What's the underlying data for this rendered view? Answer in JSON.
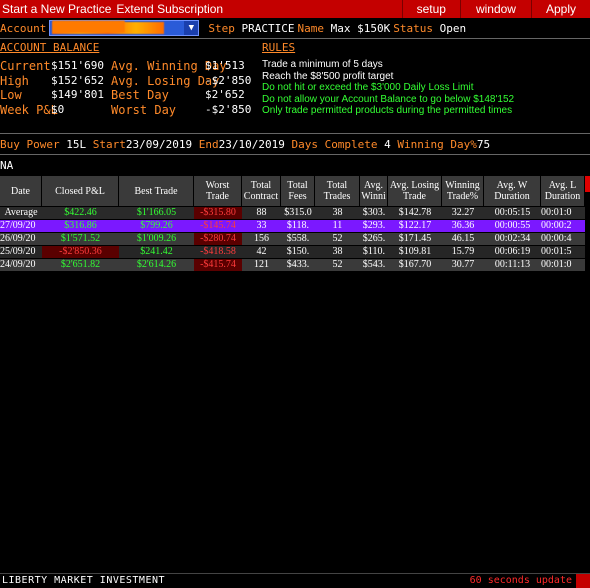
{
  "menu": {
    "start_label": "Start a New Practice",
    "extend_label": "Extend Subscription",
    "setup_label": "setup",
    "window_label": "window",
    "apply_label": "Apply"
  },
  "account": {
    "label": "Account",
    "value": "████████████",
    "step_label": "Step",
    "step_value": "PRACTICE",
    "name_label": "Name",
    "name_value": "Max $150K",
    "status_label": "Status",
    "status_value": "Open"
  },
  "balance": {
    "title": "ACCOUNT BALANCE",
    "rows": [
      {
        "l1": "Current",
        "v1": "$151'690",
        "l2": "Avg. Winning Day",
        "v2": "$1'513"
      },
      {
        "l1": "High",
        "v1": "$152'652",
        "l2": "Avg. Losing Day",
        "v2": "-$2'850"
      },
      {
        "l1": "Low",
        "v1": "$149'801",
        "l2": "Best Day",
        "v2": "$2'652"
      },
      {
        "l1": "Week P&L",
        "v1": "$0",
        "l2": "Worst Day",
        "v2": "-$2'850"
      }
    ]
  },
  "rules": {
    "title": "RULES",
    "items": [
      {
        "text": "Trade a minimum of 5 days",
        "color": "white"
      },
      {
        "text": "Reach the $8'500 profit target",
        "color": "white"
      },
      {
        "text": "Do not hit or exceed the $3'000 Daily Loss Limit",
        "color": "green"
      },
      {
        "text": "Do not allow your Account Balance to go below $148'152",
        "color": "green"
      },
      {
        "text": "Only trade permitted products during the permitted times",
        "color": "green"
      }
    ]
  },
  "summary": {
    "buy_power_label": "Buy Power",
    "buy_power_value": "15L",
    "start_label": "Start",
    "start_value": "23/09/2019",
    "end_label": "End",
    "end_value": "23/10/2019",
    "days_label": "Days Complete",
    "days_value": "4",
    "winning_label": "Winning Day%",
    "winning_value": "75"
  },
  "na_text": "NA",
  "table": {
    "headers": [
      "Date",
      "Closed P&L",
      "Best Trade",
      "Worst Trade",
      "Total Contract",
      "Total Fees",
      "Total Trades",
      "Avg. Winni",
      "Avg. Losing Trade",
      "Winning Trade%",
      "Avg. W Duration",
      "Avg. L Duration"
    ],
    "average": {
      "date": "Average",
      "pnl": "$422.46",
      "best": "$1'166.05",
      "worst": "-$315.80",
      "contracts": "88",
      "fees": "$315.0",
      "trades": "38",
      "avgwin": "$303.",
      "avgloss": "$142.78",
      "winpct": "32.27",
      "wdur": "00:05:15",
      "ldur": "00:01:0"
    },
    "rows": [
      {
        "date": "27/09/20",
        "pnl": "$316.86",
        "best": "$799.26",
        "worst": "-$145.74",
        "contracts": "33",
        "fees": "$118.",
        "trades": "11",
        "avgwin": "$293.",
        "avgloss": "$122.17",
        "winpct": "36.36",
        "wdur": "00:00:55",
        "ldur": "00:00:2"
      },
      {
        "date": "26/09/20",
        "pnl": "$1'571.52",
        "best": "$1'009.26",
        "worst": "-$280.74",
        "contracts": "156",
        "fees": "$558.",
        "trades": "52",
        "avgwin": "$265.",
        "avgloss": "$171.45",
        "winpct": "46.15",
        "wdur": "00:02:34",
        "ldur": "00:00:4"
      },
      {
        "date": "25/09/20",
        "pnl": "-$2'850.36",
        "best": "$241.42",
        "worst": "-$418.58",
        "contracts": "42",
        "fees": "$150.",
        "trades": "38",
        "avgwin": "$110.",
        "avgloss": "$109.81",
        "winpct": "15.79",
        "wdur": "00:06:19",
        "ldur": "00:01:5"
      },
      {
        "date": "24/09/20",
        "pnl": "$2'651.82",
        "best": "$2'614.26",
        "worst": "-$415.74",
        "contracts": "121",
        "fees": "$433.",
        "trades": "52",
        "avgwin": "$543.",
        "avgloss": "$167.70",
        "winpct": "30.77",
        "wdur": "00:11:13",
        "ldur": "00:01:0"
      }
    ]
  },
  "footer": {
    "company": "LIBERTY MARKET INVESTMENT",
    "update": "60 seconds update"
  },
  "colors": {
    "menubar": "#c40000",
    "label_orange": "#ff8a2a",
    "selected_row": "#7b18ff",
    "positive": "#33ff33",
    "negative": "#ff3b3b"
  }
}
